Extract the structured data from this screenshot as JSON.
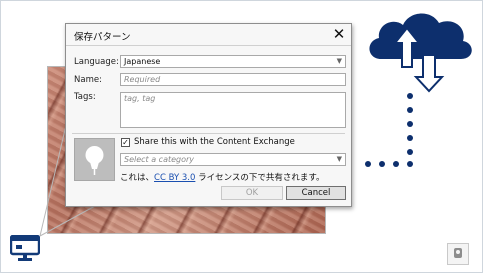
{
  "dialog": {
    "title": "保存パターン",
    "close_glyph": "✕",
    "language_label": "Language:",
    "language_value": "Japanese",
    "name_label": "Name:",
    "name_placeholder": "Required",
    "tags_label": "Tags:",
    "tags_placeholder": "tag, tag",
    "share_checked": true,
    "share_label": "Share this with the Content Exchange",
    "category_placeholder": "Select a category",
    "license_prefix": "これは、",
    "license_link": "CC BY 3.0",
    "license_suffix": " ライセンスの下で共有されます。",
    "ok_label": "OK",
    "cancel_label": "Cancel"
  },
  "colors": {
    "cloud": "#0d2f6d",
    "monitor_icon": "#123a78",
    "link": "#1a4fb0"
  },
  "icons": {
    "cloud": "cloud-upload-download-icon",
    "monitor": "monitor-icon",
    "thumbnail": "lightbulb-icon",
    "corner": "image-placeholder-icon"
  }
}
